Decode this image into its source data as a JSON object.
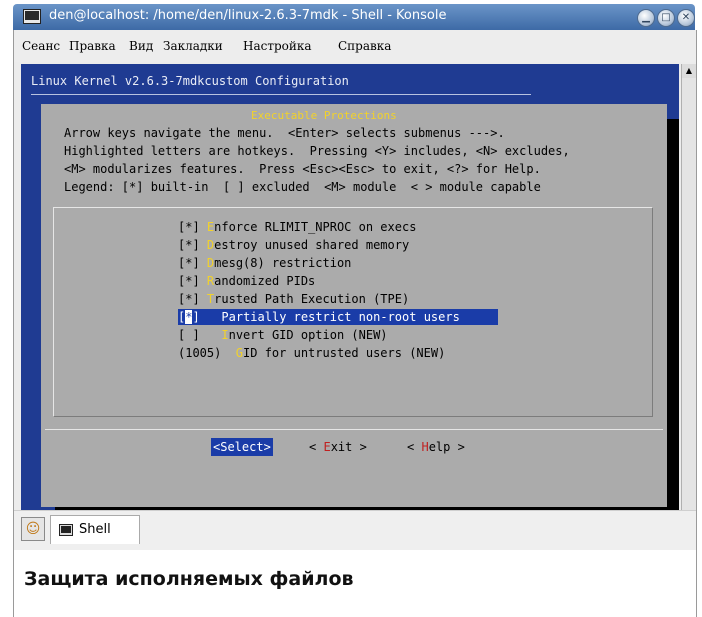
{
  "window": {
    "title": "den@localhost: /home/den/linux-2.6.3-7mdk - Shell - Konsole"
  },
  "menu": [
    "Сеанс",
    "Правка",
    "Вид",
    "Закладки",
    "Настройка",
    "Справка"
  ],
  "terminal": {
    "header": "Linux Kernel v2.6.3-7mdkcustom Configuration",
    "dialog_title": "Executable Protections",
    "help_lines": [
      "Arrow keys navigate the menu.  <Enter> selects submenus --->.",
      "Highlighted letters are hotkeys.  Pressing <Y> includes, <N> excludes,",
      "<M> modularizes features.  Press <Esc><Esc> to exit, <?> for Help.",
      "Legend: [*] built-in  [ ] excluded  <M> module  < > module capable"
    ],
    "options": [
      {
        "prefix": "[*] ",
        "hotkey": "E",
        "rest": "nforce RLIMIT_NPROC on execs"
      },
      {
        "prefix": "[*] ",
        "hotkey": "D",
        "rest": "estroy unused shared memory"
      },
      {
        "prefix": "[*] ",
        "hotkey": "D",
        "rest": "mesg(8) restriction"
      },
      {
        "prefix": "[*] ",
        "hotkey": "R",
        "rest": "andomized PIDs"
      },
      {
        "prefix": "[*] ",
        "hotkey": "T",
        "rest": "rusted Path Execution (TPE)"
      },
      {
        "open": "[",
        "mark": "*",
        "close": "]",
        "hotkey": "P",
        "rest": "artially restrict non-root users"
      },
      {
        "prefix": "[ ]   ",
        "hotkey": "I",
        "rest": "nvert GID option (NEW)"
      },
      {
        "prefix": "(1005)  ",
        "hotkey": "G",
        "rest": "ID for untrusted users (NEW)"
      }
    ],
    "buttons": {
      "select": {
        "open": "<",
        "label": "Select",
        "close": ">"
      },
      "exit": {
        "open": "< ",
        "hot": "E",
        "rest": "xit",
        "close": " >"
      },
      "help": {
        "open": "< ",
        "hot": "H",
        "rest": "elp",
        "close": " >"
      }
    }
  },
  "taskbar": {
    "tab_label": "Shell"
  },
  "caption": "Защита исполняемых файлов"
}
